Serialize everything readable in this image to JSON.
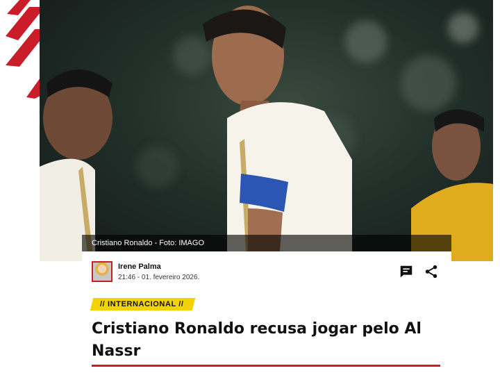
{
  "hero": {
    "caption": "Cristiano Ronaldo - Foto: IMAGO",
    "image_alt": "Cristiano Ronaldo"
  },
  "author": {
    "name": "Irene Palma",
    "datetime": "21:46 - 01. fevereiro 2026."
  },
  "article": {
    "category": "// INTERNACIONAL //",
    "title": "Cristiano Ronaldo recusa jogar pelo Al Nassr"
  },
  "colors": {
    "accent_red": "#c91d2a",
    "tag_yellow": "#f2d200"
  },
  "icons": [
    "comment-icon",
    "share-icon"
  ]
}
